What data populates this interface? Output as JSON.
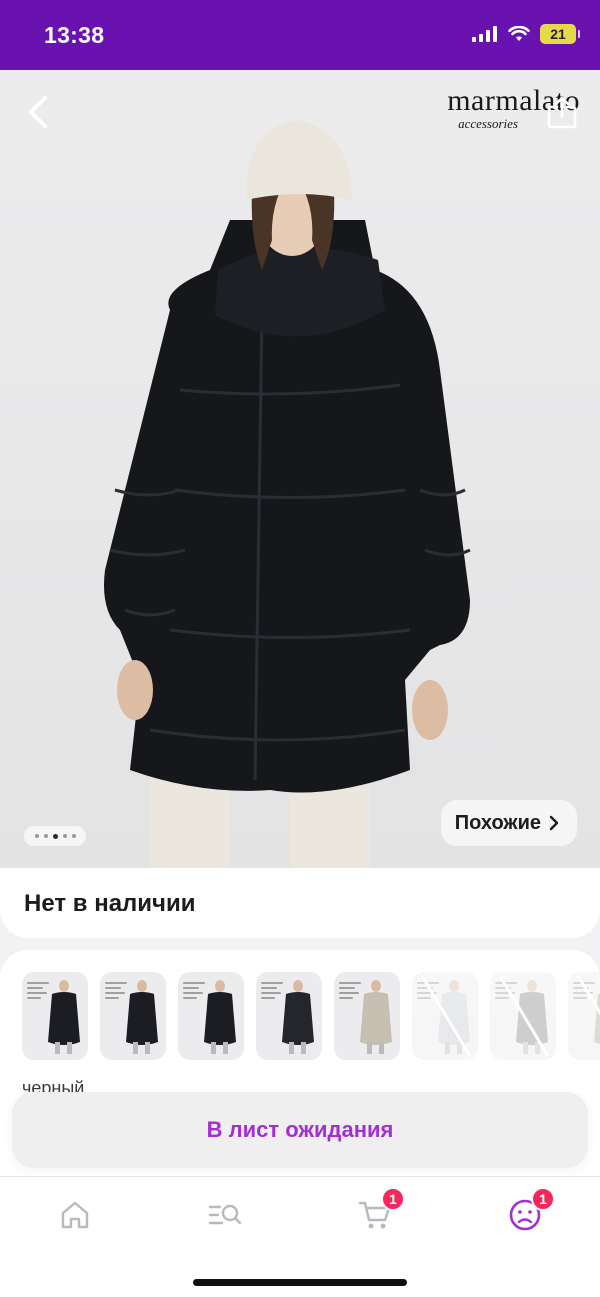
{
  "status_bar": {
    "time": "13:38",
    "battery": "21"
  },
  "brand": {
    "name": "marmalato",
    "subtitle": "accessories"
  },
  "gallery": {
    "page_count": 5,
    "active_page": 3
  },
  "similar_button": {
    "label": "Похожие"
  },
  "stock": {
    "status": "Нет в наличии"
  },
  "variants": {
    "color_label": "черный",
    "count": 8,
    "unavailable_from": 6
  },
  "waitlist_button": {
    "label": "В лист ожидания"
  },
  "tab_bar": {
    "items": [
      {
        "name": "home",
        "icon": "home-icon"
      },
      {
        "name": "catalog",
        "icon": "catalog-search-icon"
      },
      {
        "name": "cart",
        "icon": "cart-icon",
        "badge": "1"
      },
      {
        "name": "profile",
        "icon": "profile-icon",
        "badge": "1"
      }
    ]
  },
  "colors": {
    "brand_purple": "#6a12b0",
    "accent_text": "#a22fd3",
    "badge_red": "#f2285a"
  }
}
